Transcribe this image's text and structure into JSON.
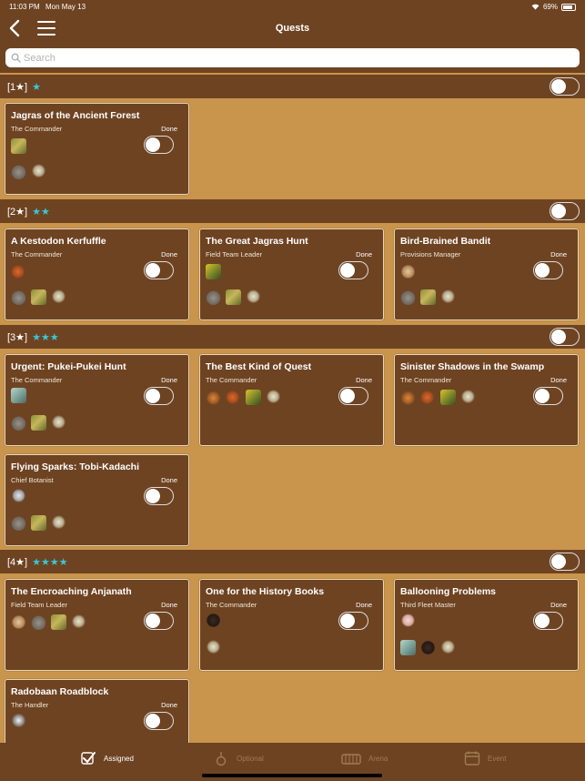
{
  "status_bar": {
    "time": "11:03 PM",
    "date": "Mon May 13",
    "battery": "69%"
  },
  "nav": {
    "title": "Quests"
  },
  "search": {
    "placeholder": "Search"
  },
  "sections": [
    {
      "label": "[1★]",
      "stars": "★",
      "cards": [
        {
          "title": "Jagras of the Ancient Forest",
          "giver": "The Commander",
          "done_label": "Done",
          "icons_top": [
            "green-monster-icon"
          ],
          "icons_bottom": [
            "gray-monster-icon",
            "crest-monster-icon"
          ]
        }
      ]
    },
    {
      "label": "[2★]",
      "stars": "★★",
      "cards": [
        {
          "title": "A Kestodon Kerfuffle",
          "giver": "The Commander",
          "done_label": "Done",
          "icons_top": [
            "orange-monster-icon"
          ],
          "icons_bottom": [
            "gray-monster-icon",
            "green-monster-icon",
            "crest-monster-icon"
          ]
        },
        {
          "title": "The Great Jagras Hunt",
          "giver": "Field Team Leader",
          "done_label": "Done",
          "icons_top": [
            "yellow-monster-icon"
          ],
          "icons_bottom": [
            "gray-monster-icon",
            "green-monster-icon",
            "crest-monster-icon"
          ]
        },
        {
          "title": "Bird-Brained Bandit",
          "giver": "Provisions Manager",
          "done_label": "Done",
          "icons_top": [
            "sand-monster-icon"
          ],
          "icons_bottom": [
            "gray-monster-icon",
            "green-monster-icon",
            "crest-monster-icon"
          ]
        }
      ]
    },
    {
      "label": "[3★]",
      "stars": "★★★",
      "cards": [
        {
          "title": "Urgent: Pukei-Pukei Hunt",
          "giver": "The Commander",
          "done_label": "Done",
          "icons_top": [
            "teal-monster-icon"
          ],
          "icons_bottom": [
            "gray-monster-icon",
            "green-monster-icon",
            "crest-monster-icon"
          ]
        },
        {
          "title": "The Best Kind of Quest",
          "giver": "The Commander",
          "done_label": "Done",
          "icons_top": [
            "crab-monster-icon",
            "orange-monster-icon",
            "yellow-monster-icon",
            "crest-monster-icon"
          ],
          "icons_bottom": []
        },
        {
          "title": "Sinister Shadows in the Swamp",
          "giver": "The Commander",
          "done_label": "Done",
          "icons_top": [
            "crab-monster-icon",
            "orange-monster-icon",
            "yellow-monster-icon",
            "crest-monster-icon"
          ],
          "icons_bottom": []
        },
        {
          "title": "Flying Sparks: Tobi-Kadachi",
          "giver": "Chief Botanist",
          "done_label": "Done",
          "icons_top": [
            "silver-monster-icon"
          ],
          "icons_bottom": [
            "gray-monster-icon",
            "green-monster-icon",
            "crest-monster-icon"
          ]
        }
      ]
    },
    {
      "label": "[4★]",
      "stars": "★★★★",
      "cards": [
        {
          "title": "The Encroaching Anjanath",
          "giver": "Field Team Leader",
          "done_label": "Done",
          "icons_top": [
            "sand-monster-icon",
            "gray-monster-icon",
            "green-monster-icon",
            "crest-monster-icon"
          ],
          "icons_bottom": []
        },
        {
          "title": "One for the History Books",
          "giver": "The Commander",
          "done_label": "Done",
          "icons_top": [
            "dark-monster-icon"
          ],
          "icons_bottom": [
            "crest-monster-icon"
          ]
        },
        {
          "title": "Ballooning Problems",
          "giver": "Third Fleet Master",
          "done_label": "Done",
          "icons_top": [
            "pink-monster-icon"
          ],
          "icons_bottom": [
            "teal-monster-icon",
            "dark-monster-icon",
            "crest-monster-icon"
          ]
        },
        {
          "title": "Radobaan Roadblock",
          "giver": "The Handler",
          "done_label": "Done",
          "icons_top": [
            "white-monster-icon"
          ],
          "icons_bottom": []
        }
      ]
    }
  ],
  "tabs": [
    {
      "label": "Assigned",
      "icon": "checkmark-badge-icon",
      "active": true
    },
    {
      "label": "Optional",
      "icon": "flask-icon",
      "active": false
    },
    {
      "label": "Arena",
      "icon": "arena-icon",
      "active": false
    },
    {
      "label": "Event",
      "icon": "calendar-icon",
      "active": false
    }
  ]
}
